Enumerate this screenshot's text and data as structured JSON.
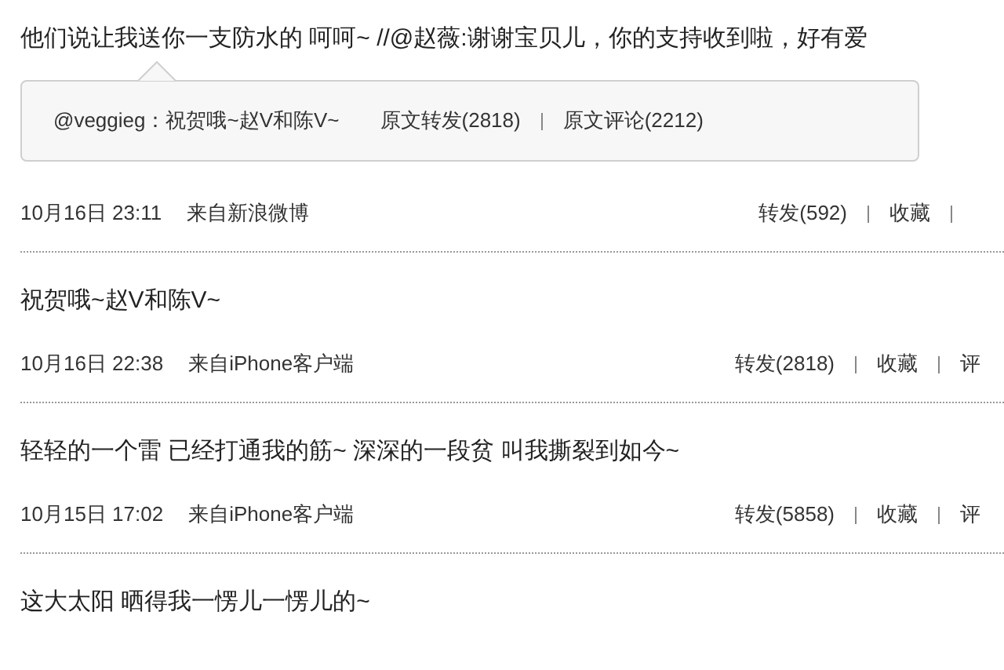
{
  "posts": [
    {
      "text": "他们说让我送你一支防水的 呵呵~ //@赵薇:谢谢宝贝儿，你的支持收到啦，好有爱",
      "quote": {
        "text": "@veggieg：祝贺哦~赵V和陈V~",
        "links": [
          "原文转发(2818)",
          "原文评论(2212)"
        ]
      },
      "time": "10月16日 23:11",
      "source": "来自新浪微博",
      "actions": [
        "转发(592)",
        "收藏"
      ],
      "trailing_divider": true
    },
    {
      "text": "祝贺哦~赵V和陈V~",
      "time": "10月16日 22:38",
      "source": "来自iPhone客户端",
      "actions": [
        "转发(2818)",
        "收藏",
        "评"
      ]
    },
    {
      "text": "轻轻的一个雷 已经打通我的筋~ 深深的一段贫 叫我撕裂到如今~",
      "time": "10月15日 17:02",
      "source": "来自iPhone客户端",
      "actions": [
        "转发(5858)",
        "收藏",
        "评"
      ]
    },
    {
      "text": "这大太阳 晒得我一愣儿一愣儿的~"
    }
  ]
}
